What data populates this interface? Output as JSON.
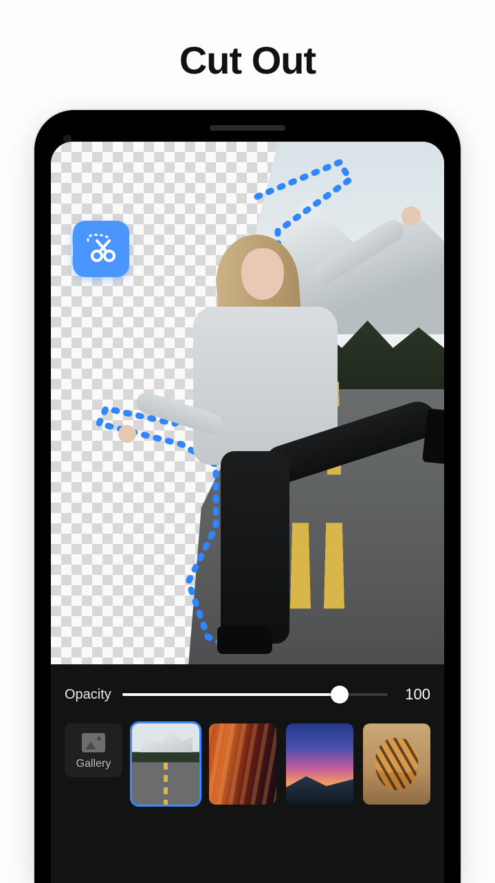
{
  "page": {
    "title": "Cut Out"
  },
  "tool": {
    "icon_name": "scissors-lasso-icon"
  },
  "slider": {
    "label": "Opacity",
    "value": "100",
    "percent": 82
  },
  "gallery": {
    "label": "Gallery",
    "icon_name": "image-icon"
  },
  "backgrounds": [
    {
      "id": "road",
      "label": "Mountain road",
      "selected": true
    },
    {
      "id": "canyon",
      "label": "Red canyon",
      "selected": false
    },
    {
      "id": "sunset",
      "label": "Purple sunset",
      "selected": false
    },
    {
      "id": "tiger",
      "label": "Tiger",
      "selected": false
    }
  ],
  "colors": {
    "accent": "#3b8bff",
    "tool_badge": "#4b95ff"
  }
}
